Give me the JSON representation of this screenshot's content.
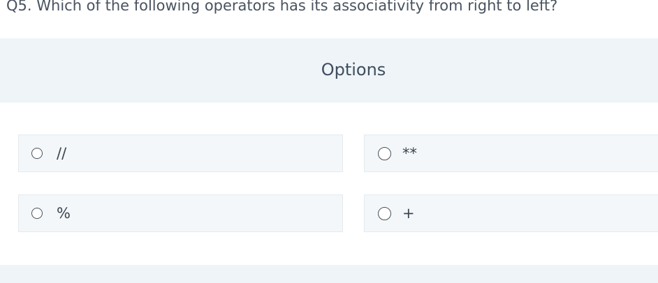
{
  "question": {
    "text": "Q5. Which of the following operators has its associativity from right to left?"
  },
  "options_section": {
    "title": "Options"
  },
  "options": [
    {
      "label": "//"
    },
    {
      "label": "**"
    },
    {
      "label": "%"
    },
    {
      "label": "+"
    }
  ],
  "colors": {
    "header_background": "#eef4f7",
    "option_background": "#f3f7f9",
    "option_border": "#e4eaee",
    "text": "#3f4a57"
  }
}
